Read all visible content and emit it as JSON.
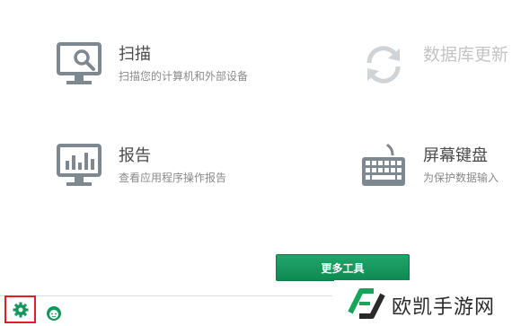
{
  "tools": {
    "scan": {
      "title": "扫描",
      "desc": "扫描您的计算机和外部设备",
      "icon": "monitor-magnifier-icon"
    },
    "update": {
      "title": "数据库更新",
      "desc": "",
      "icon": "refresh-icon",
      "disabled": true
    },
    "report": {
      "title": "报告",
      "desc": "查看应用程序操作报告",
      "icon": "monitor-chart-icon"
    },
    "keyboard": {
      "title": "屏幕键盘",
      "desc": "为保护数据输入",
      "icon": "keyboard-icon"
    }
  },
  "more_tools_label": "更多工具",
  "footer": {
    "settings_icon": "gear-icon",
    "profile_icon": "support-avatar-icon"
  },
  "watermark": {
    "text": "欧凯手游网",
    "logo_color": "#1aa35a"
  },
  "colors": {
    "accent": "#13955c",
    "icon_gray": "#7d8891",
    "highlight_border": "#e02020"
  }
}
